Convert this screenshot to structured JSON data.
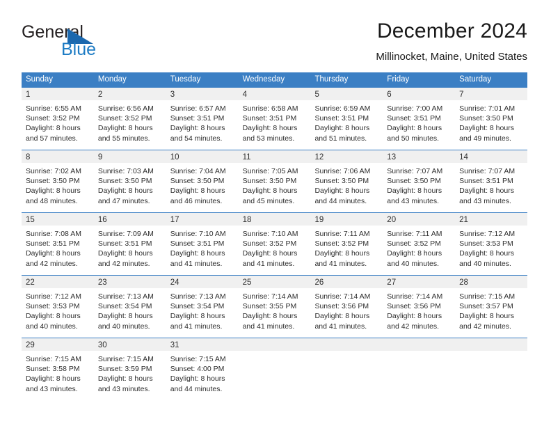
{
  "brand": {
    "name_part1": "General",
    "name_part2": "Blue"
  },
  "header": {
    "title": "December 2024",
    "subtitle": "Millinocket, Maine, United States"
  },
  "colors": {
    "header_blue": "#3b7fc4",
    "brand_blue": "#1c7bc4",
    "daynum_band": "#f0f0f0",
    "text": "#2d2d2d"
  },
  "weekdays": [
    "Sunday",
    "Monday",
    "Tuesday",
    "Wednesday",
    "Thursday",
    "Friday",
    "Saturday"
  ],
  "weeks": [
    [
      {
        "day": "1",
        "sunrise": "Sunrise: 6:55 AM",
        "sunset": "Sunset: 3:52 PM",
        "daylight1": "Daylight: 8 hours",
        "daylight2": "and 57 minutes."
      },
      {
        "day": "2",
        "sunrise": "Sunrise: 6:56 AM",
        "sunset": "Sunset: 3:52 PM",
        "daylight1": "Daylight: 8 hours",
        "daylight2": "and 55 minutes."
      },
      {
        "day": "3",
        "sunrise": "Sunrise: 6:57 AM",
        "sunset": "Sunset: 3:51 PM",
        "daylight1": "Daylight: 8 hours",
        "daylight2": "and 54 minutes."
      },
      {
        "day": "4",
        "sunrise": "Sunrise: 6:58 AM",
        "sunset": "Sunset: 3:51 PM",
        "daylight1": "Daylight: 8 hours",
        "daylight2": "and 53 minutes."
      },
      {
        "day": "5",
        "sunrise": "Sunrise: 6:59 AM",
        "sunset": "Sunset: 3:51 PM",
        "daylight1": "Daylight: 8 hours",
        "daylight2": "and 51 minutes."
      },
      {
        "day": "6",
        "sunrise": "Sunrise: 7:00 AM",
        "sunset": "Sunset: 3:51 PM",
        "daylight1": "Daylight: 8 hours",
        "daylight2": "and 50 minutes."
      },
      {
        "day": "7",
        "sunrise": "Sunrise: 7:01 AM",
        "sunset": "Sunset: 3:50 PM",
        "daylight1": "Daylight: 8 hours",
        "daylight2": "and 49 minutes."
      }
    ],
    [
      {
        "day": "8",
        "sunrise": "Sunrise: 7:02 AM",
        "sunset": "Sunset: 3:50 PM",
        "daylight1": "Daylight: 8 hours",
        "daylight2": "and 48 minutes."
      },
      {
        "day": "9",
        "sunrise": "Sunrise: 7:03 AM",
        "sunset": "Sunset: 3:50 PM",
        "daylight1": "Daylight: 8 hours",
        "daylight2": "and 47 minutes."
      },
      {
        "day": "10",
        "sunrise": "Sunrise: 7:04 AM",
        "sunset": "Sunset: 3:50 PM",
        "daylight1": "Daylight: 8 hours",
        "daylight2": "and 46 minutes."
      },
      {
        "day": "11",
        "sunrise": "Sunrise: 7:05 AM",
        "sunset": "Sunset: 3:50 PM",
        "daylight1": "Daylight: 8 hours",
        "daylight2": "and 45 minutes."
      },
      {
        "day": "12",
        "sunrise": "Sunrise: 7:06 AM",
        "sunset": "Sunset: 3:50 PM",
        "daylight1": "Daylight: 8 hours",
        "daylight2": "and 44 minutes."
      },
      {
        "day": "13",
        "sunrise": "Sunrise: 7:07 AM",
        "sunset": "Sunset: 3:50 PM",
        "daylight1": "Daylight: 8 hours",
        "daylight2": "and 43 minutes."
      },
      {
        "day": "14",
        "sunrise": "Sunrise: 7:07 AM",
        "sunset": "Sunset: 3:51 PM",
        "daylight1": "Daylight: 8 hours",
        "daylight2": "and 43 minutes."
      }
    ],
    [
      {
        "day": "15",
        "sunrise": "Sunrise: 7:08 AM",
        "sunset": "Sunset: 3:51 PM",
        "daylight1": "Daylight: 8 hours",
        "daylight2": "and 42 minutes."
      },
      {
        "day": "16",
        "sunrise": "Sunrise: 7:09 AM",
        "sunset": "Sunset: 3:51 PM",
        "daylight1": "Daylight: 8 hours",
        "daylight2": "and 42 minutes."
      },
      {
        "day": "17",
        "sunrise": "Sunrise: 7:10 AM",
        "sunset": "Sunset: 3:51 PM",
        "daylight1": "Daylight: 8 hours",
        "daylight2": "and 41 minutes."
      },
      {
        "day": "18",
        "sunrise": "Sunrise: 7:10 AM",
        "sunset": "Sunset: 3:52 PM",
        "daylight1": "Daylight: 8 hours",
        "daylight2": "and 41 minutes."
      },
      {
        "day": "19",
        "sunrise": "Sunrise: 7:11 AM",
        "sunset": "Sunset: 3:52 PM",
        "daylight1": "Daylight: 8 hours",
        "daylight2": "and 41 minutes."
      },
      {
        "day": "20",
        "sunrise": "Sunrise: 7:11 AM",
        "sunset": "Sunset: 3:52 PM",
        "daylight1": "Daylight: 8 hours",
        "daylight2": "and 40 minutes."
      },
      {
        "day": "21",
        "sunrise": "Sunrise: 7:12 AM",
        "sunset": "Sunset: 3:53 PM",
        "daylight1": "Daylight: 8 hours",
        "daylight2": "and 40 minutes."
      }
    ],
    [
      {
        "day": "22",
        "sunrise": "Sunrise: 7:12 AM",
        "sunset": "Sunset: 3:53 PM",
        "daylight1": "Daylight: 8 hours",
        "daylight2": "and 40 minutes."
      },
      {
        "day": "23",
        "sunrise": "Sunrise: 7:13 AM",
        "sunset": "Sunset: 3:54 PM",
        "daylight1": "Daylight: 8 hours",
        "daylight2": "and 40 minutes."
      },
      {
        "day": "24",
        "sunrise": "Sunrise: 7:13 AM",
        "sunset": "Sunset: 3:54 PM",
        "daylight1": "Daylight: 8 hours",
        "daylight2": "and 41 minutes."
      },
      {
        "day": "25",
        "sunrise": "Sunrise: 7:14 AM",
        "sunset": "Sunset: 3:55 PM",
        "daylight1": "Daylight: 8 hours",
        "daylight2": "and 41 minutes."
      },
      {
        "day": "26",
        "sunrise": "Sunrise: 7:14 AM",
        "sunset": "Sunset: 3:56 PM",
        "daylight1": "Daylight: 8 hours",
        "daylight2": "and 41 minutes."
      },
      {
        "day": "27",
        "sunrise": "Sunrise: 7:14 AM",
        "sunset": "Sunset: 3:56 PM",
        "daylight1": "Daylight: 8 hours",
        "daylight2": "and 42 minutes."
      },
      {
        "day": "28",
        "sunrise": "Sunrise: 7:15 AM",
        "sunset": "Sunset: 3:57 PM",
        "daylight1": "Daylight: 8 hours",
        "daylight2": "and 42 minutes."
      }
    ],
    [
      {
        "day": "29",
        "sunrise": "Sunrise: 7:15 AM",
        "sunset": "Sunset: 3:58 PM",
        "daylight1": "Daylight: 8 hours",
        "daylight2": "and 43 minutes."
      },
      {
        "day": "30",
        "sunrise": "Sunrise: 7:15 AM",
        "sunset": "Sunset: 3:59 PM",
        "daylight1": "Daylight: 8 hours",
        "daylight2": "and 43 minutes."
      },
      {
        "day": "31",
        "sunrise": "Sunrise: 7:15 AM",
        "sunset": "Sunset: 4:00 PM",
        "daylight1": "Daylight: 8 hours",
        "daylight2": "and 44 minutes."
      },
      {
        "day": "",
        "sunrise": "",
        "sunset": "",
        "daylight1": "",
        "daylight2": ""
      },
      {
        "day": "",
        "sunrise": "",
        "sunset": "",
        "daylight1": "",
        "daylight2": ""
      },
      {
        "day": "",
        "sunrise": "",
        "sunset": "",
        "daylight1": "",
        "daylight2": ""
      },
      {
        "day": "",
        "sunrise": "",
        "sunset": "",
        "daylight1": "",
        "daylight2": ""
      }
    ]
  ]
}
